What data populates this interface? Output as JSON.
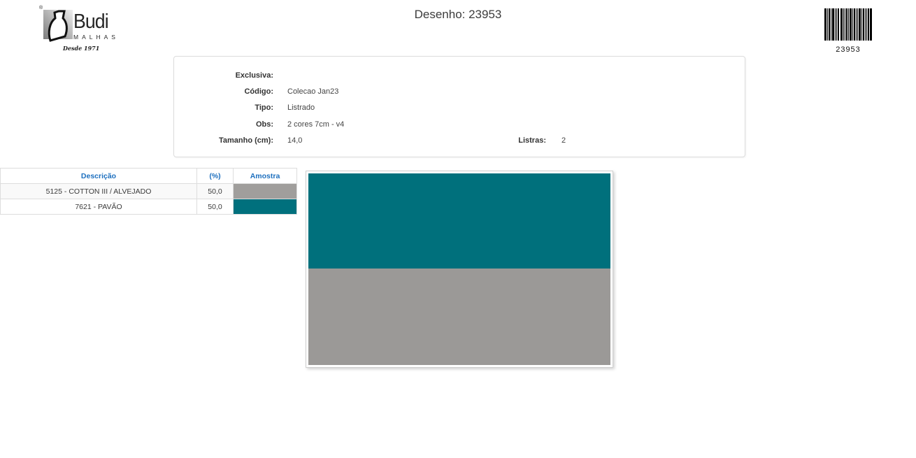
{
  "page": {
    "title": "Desenho: 23953"
  },
  "logo": {
    "registered_symbol": "®",
    "name": "Budi",
    "subtitle": "MALHAS",
    "tagline": "Desde 1971"
  },
  "barcode": {
    "value": "23953"
  },
  "info_panel": {
    "rows": [
      {
        "label": "Exclusiva:",
        "value": ""
      },
      {
        "label": "Código:",
        "value": "Colecao Jan23"
      },
      {
        "label": "Tipo:",
        "value": "Listrado"
      },
      {
        "label": "Obs:",
        "value": "2 cores 7cm - v4"
      },
      {
        "label": "Tamanho (cm):",
        "value": "14,0",
        "label2": "Listras:",
        "value2": "2"
      }
    ]
  },
  "composition_table": {
    "headers": {
      "descricao": "Descrição",
      "percent": "(%)",
      "amostra": "Amostra"
    },
    "rows": [
      {
        "descricao": "5125 - COTTON III / ALVEJADO",
        "percent": "50,0",
        "color": "#a09e9c"
      },
      {
        "descricao": "7621 - PAVÃO",
        "percent": "50,0",
        "color": "#00707d"
      }
    ]
  },
  "preview": {
    "stripes": [
      {
        "name": "PAVÃO",
        "color": "#00707c"
      },
      {
        "name": "COTTON III / ALVEJADO",
        "color": "#9b9997"
      }
    ]
  },
  "colors": {
    "table_header_blue": "#1e70bf",
    "teal": "#00707c",
    "gray": "#9b9997"
  }
}
